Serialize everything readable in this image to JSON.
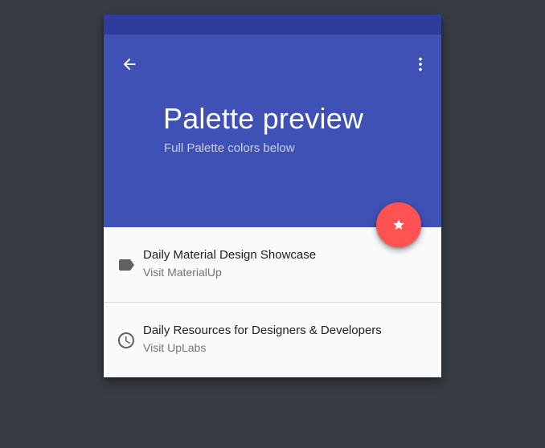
{
  "app": {
    "title": "Palette preview",
    "subtitle": "Full Palette colors below"
  },
  "header": {
    "back_icon": "arrow-back-icon",
    "menu_icon": "more-vert-icon"
  },
  "fab": {
    "icon": "star-icon",
    "color": "#ff5252"
  },
  "list": {
    "items": [
      {
        "icon": "label-tag-icon",
        "primary": "Daily Material Design Showcase",
        "secondary": "Visit MaterialUp"
      },
      {
        "icon": "clock-icon",
        "primary": "Daily Resources for Designers & Developers",
        "secondary": "Visit UpLabs"
      }
    ]
  },
  "colors": {
    "primary": "#3f51b5",
    "primary_dark": "#2f3c9c",
    "accent": "#ff5252",
    "background": "#373d43",
    "surface": "#fafafa"
  }
}
